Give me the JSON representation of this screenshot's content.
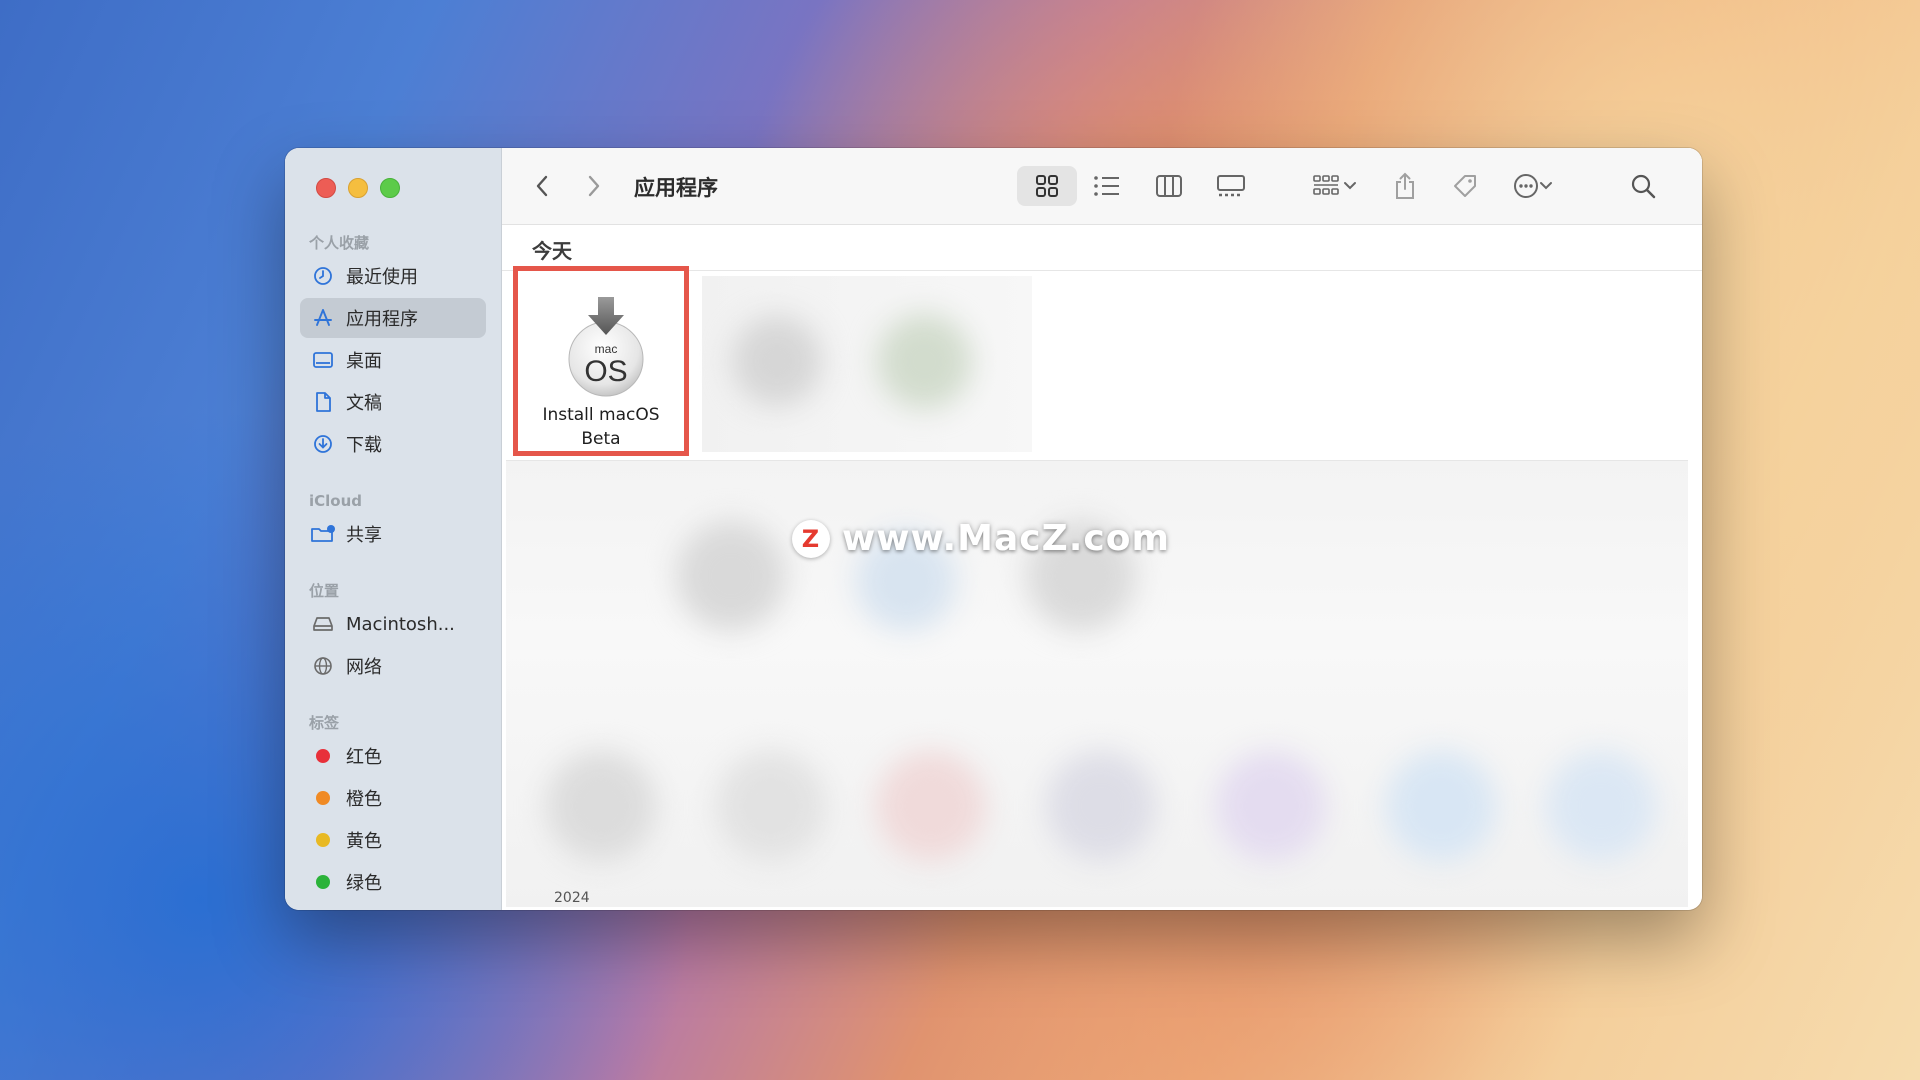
{
  "window": {
    "title": "应用程序",
    "group_header": "今天"
  },
  "sidebar": {
    "favorites_title": "个人收藏",
    "favorites": [
      {
        "label": "最近使用",
        "icon": "clock-icon"
      },
      {
        "label": "应用程序",
        "icon": "applications-icon",
        "selected": true
      },
      {
        "label": "桌面",
        "icon": "desktop-icon"
      },
      {
        "label": "文稿",
        "icon": "document-icon"
      },
      {
        "label": "下载",
        "icon": "download-icon"
      }
    ],
    "icloud_title": "iCloud",
    "icloud": [
      {
        "label": "共享",
        "icon": "shared-folder-icon"
      }
    ],
    "locations_title": "位置",
    "locations": [
      {
        "label": "Macintosh...",
        "icon": "hard-drive-icon"
      },
      {
        "label": "网络",
        "icon": "network-icon"
      }
    ],
    "tags_title": "标签",
    "tags": [
      {
        "label": "红色",
        "color": "#e8303a"
      },
      {
        "label": "橙色",
        "color": "#f08a24"
      },
      {
        "label": "黄色",
        "color": "#e8b923"
      },
      {
        "label": "绿色",
        "color": "#2bb33a"
      }
    ]
  },
  "files": {
    "selected_app": {
      "line1": "Install macOS",
      "line2": "Beta",
      "icon_text_top": "mac",
      "icon_text_main": "OS"
    },
    "partial_year": "2024"
  },
  "watermark": {
    "badge": "Z",
    "text": "www.MacZ.com"
  },
  "colors": {
    "highlight_border": "#e5564a",
    "sidebar_bg": "#dbe2ea",
    "accent_blue": "#2f74d9"
  }
}
